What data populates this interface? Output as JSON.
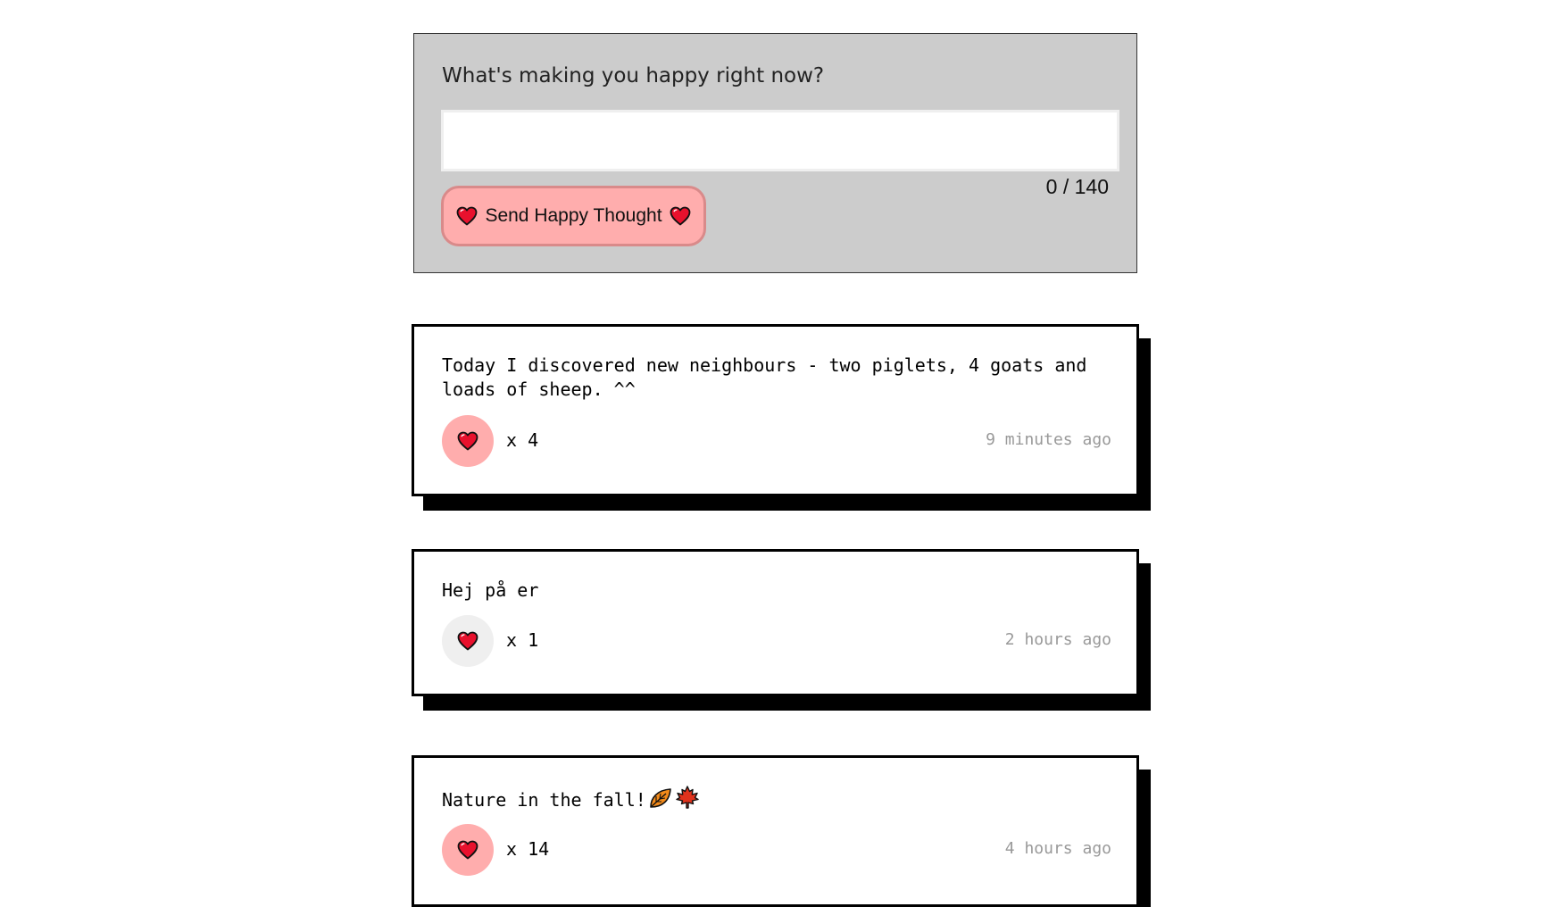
{
  "form": {
    "question": "What's making you happy right now?",
    "input_value": "",
    "input_placeholder": "",
    "char_count": "0 / 140",
    "send_label": "Send Happy Thought",
    "button_color": "#ffadad"
  },
  "thoughts": [
    {
      "message": "Today I discovered new neighbours - two piglets, 4 goats and loads of sheep. ^^",
      "like_text": "x 4",
      "time": "9 minutes ago",
      "liked": true
    },
    {
      "message": "Hej på er",
      "like_text": "x 1",
      "time": "2 hours ago",
      "liked": false
    },
    {
      "message": "Nature in the fall!",
      "emoji_icons": [
        "fallen-leaf-icon",
        "maple-leaf-icon"
      ],
      "like_text": "x 14",
      "time": "4 hours ago",
      "liked": true
    }
  ],
  "colors": {
    "heart": "#e8112d",
    "liked_bg": "#ffadad",
    "unliked_bg": "#efefef",
    "form_bg": "#cccccc",
    "shadow": "#000000"
  }
}
